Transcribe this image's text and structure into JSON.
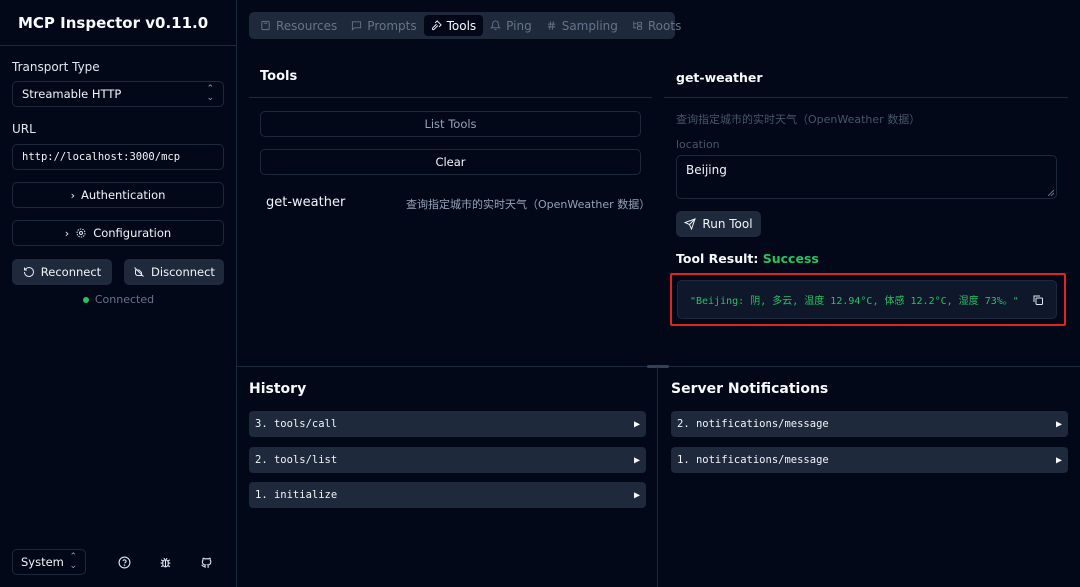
{
  "app": {
    "title": "MCP Inspector v0.11.0"
  },
  "sidebar": {
    "transport_label": "Transport Type",
    "transport_value": "Streamable HTTP",
    "url_label": "URL",
    "url_value": "http://localhost:3000/mcp",
    "authentication_label": "Authentication",
    "configuration_label": "Configuration",
    "reconnect_label": "Reconnect",
    "disconnect_label": "Disconnect",
    "status_text": "Connected",
    "status_color": "#22c55e",
    "theme_value": "System"
  },
  "tabs": [
    {
      "label": "Resources",
      "icon": "resources-icon",
      "active": false
    },
    {
      "label": "Prompts",
      "icon": "prompts-icon",
      "active": false
    },
    {
      "label": "Tools",
      "icon": "hammer-icon",
      "active": true
    },
    {
      "label": "Ping",
      "icon": "bell-icon",
      "active": false
    },
    {
      "label": "Sampling",
      "icon": "hash-icon",
      "active": false
    },
    {
      "label": "Roots",
      "icon": "folder-tree-icon",
      "active": false
    }
  ],
  "tools_panel": {
    "title": "Tools",
    "list_tools_label": "List Tools",
    "clear_label": "Clear",
    "tools": [
      {
        "name": "get-weather",
        "description": "查询指定城市的实时天气（OpenWeather 数据）"
      }
    ]
  },
  "tool_detail": {
    "title": "get-weather",
    "description": "查询指定城市的实时天气（OpenWeather 数据）",
    "param_label": "location",
    "param_value": "Beijing",
    "run_label": "Run Tool",
    "result_label": "Tool Result:",
    "result_status": "Success",
    "result_status_color": "#22c55e",
    "result_text": "\"Beijing: 阴, 多云, 温度 12.94°C, 体感 12.2°C, 湿度 73%。\""
  },
  "history": {
    "title": "History",
    "items": [
      "3. tools/call",
      "2. tools/list",
      "1. initialize"
    ]
  },
  "notifications": {
    "title": "Server Notifications",
    "items": [
      "2. notifications/message",
      "1. notifications/message"
    ]
  },
  "highlight_color": "#e02424"
}
